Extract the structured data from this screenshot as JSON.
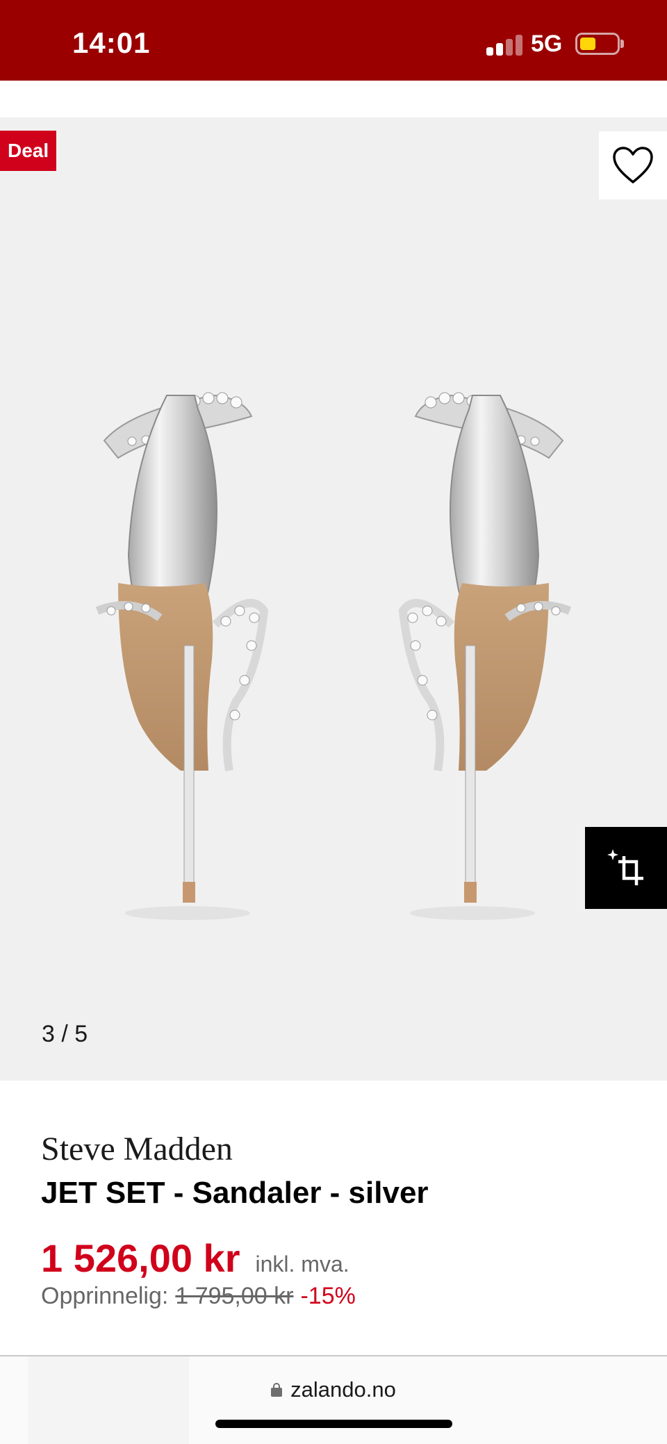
{
  "status_bar": {
    "time": "14:01",
    "network": "5G",
    "battery_color": "#ffd60a",
    "background": "#9a0000"
  },
  "gallery": {
    "deal_badge": "Deal",
    "page_indicator": "3 / 5",
    "wishlist_icon": "heart-icon",
    "crop_icon": "ai-crop-icon"
  },
  "product": {
    "brand": "Steve Madden",
    "name": "JET SET - Sandaler - silver",
    "price": "1 526,00 kr",
    "vat_note": "inkl. mva.",
    "original_label": "Opprinnelig:",
    "original_price": "1 795,00 kr",
    "discount": "-15%",
    "accent_color": "#d0021b"
  },
  "browser": {
    "url": "zalando.no"
  }
}
